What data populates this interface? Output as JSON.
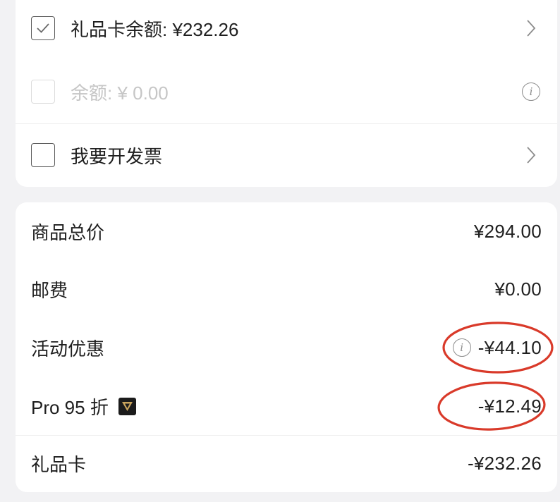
{
  "options": [
    {
      "label": "礼品卡余额: ¥232.26",
      "checked": true,
      "disabled": false,
      "trailing_icon": "chevron-right-icon"
    },
    {
      "label": "余额: ¥ 0.00",
      "checked": false,
      "disabled": true,
      "trailing_icon": "info-icon"
    },
    {
      "label": "我要开发票",
      "checked": false,
      "disabled": false,
      "trailing_icon": "chevron-right-icon"
    }
  ],
  "summary": {
    "rows": [
      {
        "label": "商品总价",
        "value": "¥294.00"
      },
      {
        "label": "邮费",
        "value": "¥0.00"
      },
      {
        "label": "活动优惠",
        "value": "-¥44.10",
        "icon": "info-icon"
      },
      {
        "label": "Pro 95 折",
        "value": "-¥12.49",
        "badge": "pro-badge-icon"
      },
      {
        "label": "礼品卡",
        "value": "-¥232.26"
      }
    ]
  },
  "info_glyph": "i",
  "colors": {
    "background": "#f2f2f4",
    "card": "#ffffff",
    "text": "#1f1f1f",
    "disabled_text": "#c6c6c6",
    "icon": "#8c8c8c",
    "badge_bg": "#1b1b1b",
    "badge_gold": "#c9a45c",
    "annotation": "#d93a2a"
  }
}
